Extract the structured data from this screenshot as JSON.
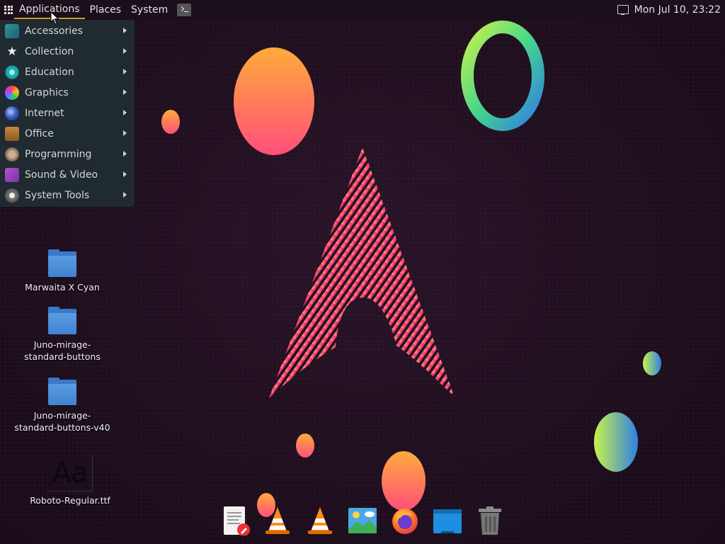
{
  "top_panel": {
    "menus": [
      {
        "label": "Applications"
      },
      {
        "label": "Places"
      },
      {
        "label": "System"
      }
    ],
    "clock": "Mon Jul 10, 23:22"
  },
  "app_menu": {
    "items": [
      {
        "label": "Accessories",
        "icon": "accessories-icon"
      },
      {
        "label": "Collection",
        "icon": "star-icon"
      },
      {
        "label": "Education",
        "icon": "education-icon"
      },
      {
        "label": "Graphics",
        "icon": "graphics-icon"
      },
      {
        "label": "Internet",
        "icon": "internet-icon"
      },
      {
        "label": "Office",
        "icon": "office-icon"
      },
      {
        "label": "Programming",
        "icon": "programming-icon"
      },
      {
        "label": "Sound & Video",
        "icon": "sound-video-icon"
      },
      {
        "label": "System Tools",
        "icon": "system-tools-icon"
      }
    ]
  },
  "desktop": {
    "icons": [
      {
        "label": "Marwaita X Cyan",
        "type": "folder"
      },
      {
        "label": "Juno-mirage-\nstandard-buttons",
        "type": "folder"
      },
      {
        "label": "Juno-mirage-\nstandard-buttons-v40",
        "type": "folder"
      },
      {
        "label": "Roboto-Regular.ttf",
        "type": "font",
        "preview": "Aa"
      }
    ]
  },
  "dock": {
    "items": [
      {
        "name": "text-editor-icon"
      },
      {
        "name": "vlc-icon"
      },
      {
        "name": "vlc-icon"
      },
      {
        "name": "image-viewer-icon"
      },
      {
        "name": "firefox-icon"
      },
      {
        "name": "file-manager-icon"
      },
      {
        "name": "trash-icon"
      }
    ]
  },
  "colors": {
    "panel_bg": "#1b0f1b",
    "menu_bg": "#1f2a31",
    "active_underline": "#c9a227",
    "folder_blue": "#3f83d2"
  }
}
